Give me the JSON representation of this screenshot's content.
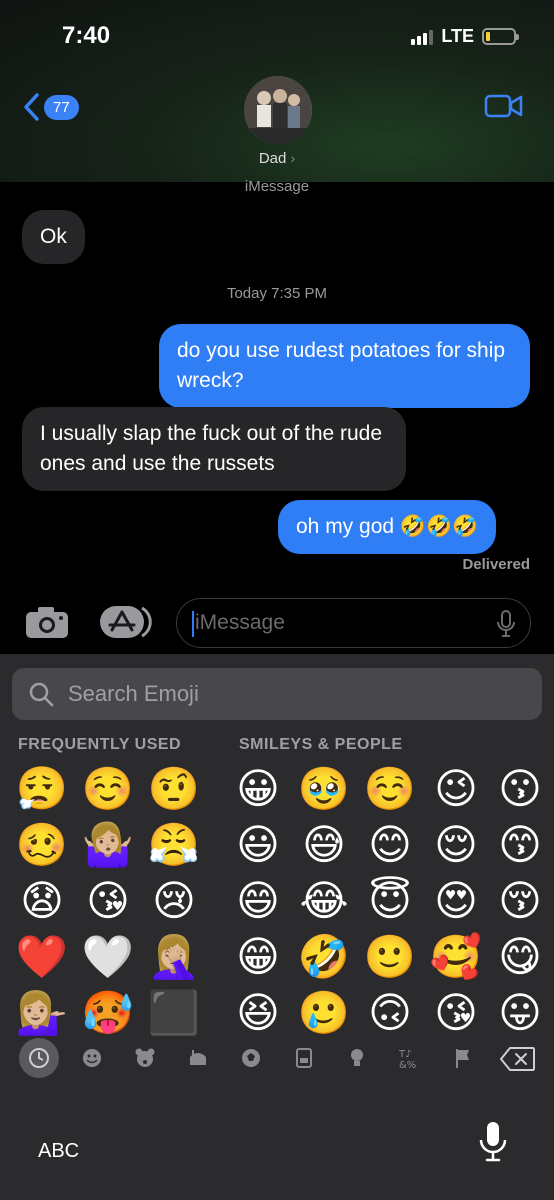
{
  "status": {
    "time": "7:40",
    "network": "LTE"
  },
  "header": {
    "back_count": "77",
    "contact_name": "Dad",
    "service": "iMessage"
  },
  "messages": [
    {
      "dir": "received",
      "text": "Ok"
    },
    {
      "dir": "sent",
      "text": "do you use rudest potatoes for ship wreck?"
    },
    {
      "dir": "received",
      "text": "I usually slap the fuck out of the rude ones and use the russets"
    },
    {
      "dir": "sent",
      "text": "oh my god 🤣🤣🤣"
    }
  ],
  "timestamp": "Today 7:35 PM",
  "delivered": "Delivered",
  "input": {
    "placeholder": "iMessage"
  },
  "keyboard": {
    "search_placeholder": "Search Emoji",
    "frequently_used_label": "FREQUENTLY USED",
    "smileys_label": "SMILEYS & PEOPLE",
    "frequently_used": [
      [
        "😮‍💨",
        "☺️",
        "🤨"
      ],
      [
        "🥴",
        "🤷🏼‍♀️",
        "😤"
      ],
      [
        "😧",
        "😘",
        "😢"
      ],
      [
        "❤️",
        "🤍",
        "🤦🏼‍♀️"
      ],
      [
        "💁🏼‍♀️",
        "🥵",
        "⬛"
      ]
    ],
    "smileys": [
      [
        "😀",
        "🥹",
        "☺️",
        "😉",
        "😗"
      ],
      [
        "😃",
        "😅",
        "😊",
        "😌",
        "😙"
      ],
      [
        "😄",
        "😂",
        "😇",
        "😍",
        "😚"
      ],
      [
        "😁",
        "🤣",
        "🙂",
        "🥰",
        "😋"
      ],
      [
        "😆",
        "🥲",
        "🙃",
        "😘",
        "😛"
      ]
    ],
    "abc_label": "ABC"
  }
}
